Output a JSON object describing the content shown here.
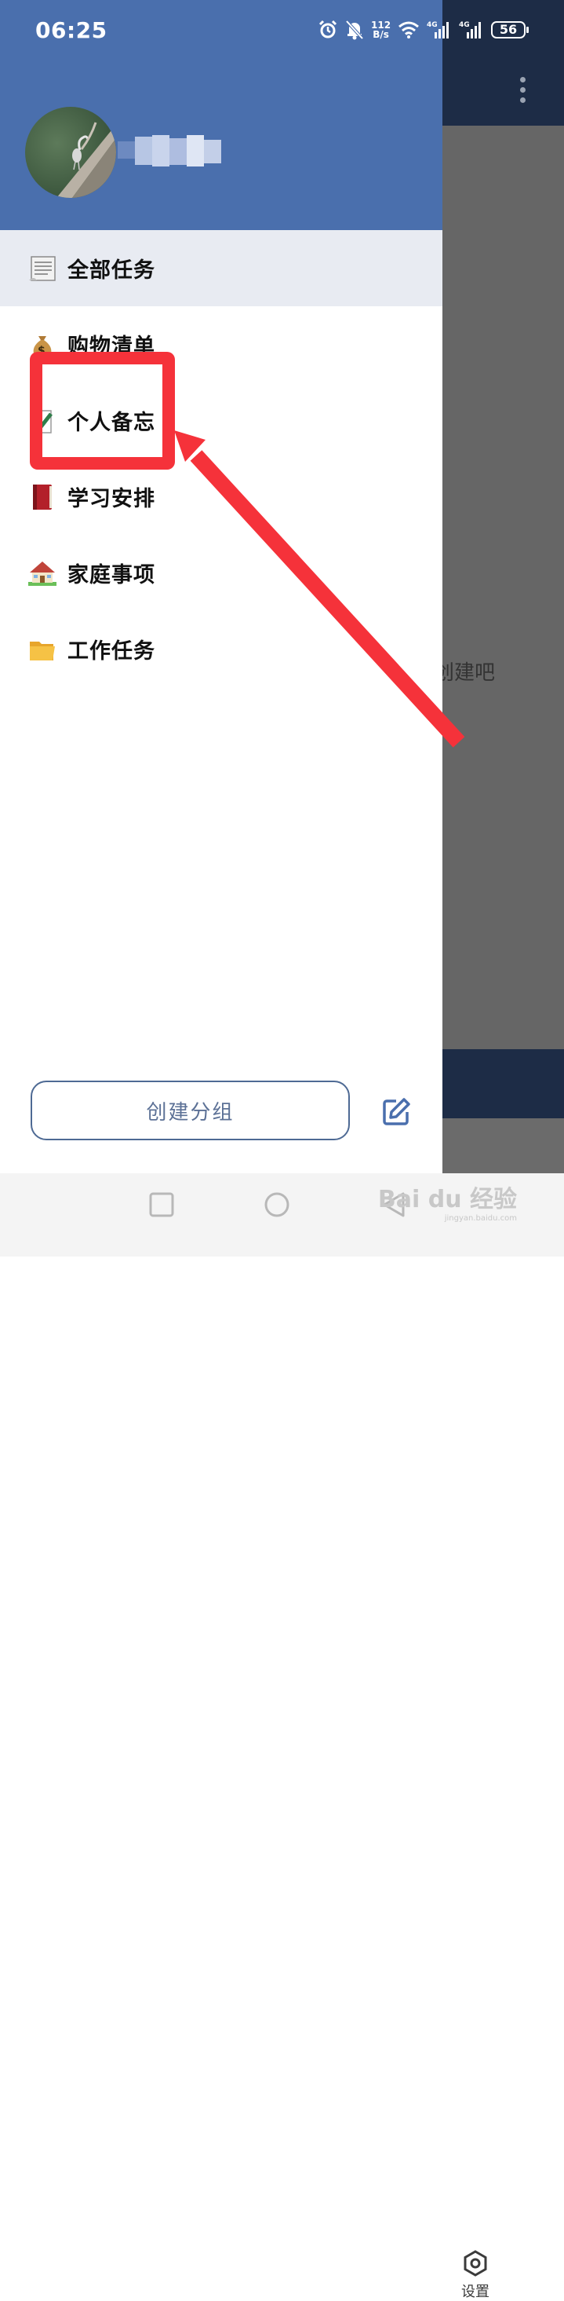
{
  "status_bar": {
    "time": "06:25",
    "net_speed_value": "112",
    "net_speed_unit": "B/s",
    "battery": "56",
    "icons": [
      "alarm-icon",
      "bell-off-icon",
      "wifi-icon",
      "signal-4g-icon",
      "signal-4g-icon",
      "battery-icon"
    ]
  },
  "drawer": {
    "nav_items": [
      {
        "label": "全部任务",
        "icon": "document-icon",
        "active": true
      },
      {
        "label": "购物清单",
        "icon": "money-bag-icon",
        "active": false
      },
      {
        "label": "个人备忘",
        "icon": "memo-icon",
        "active": false
      },
      {
        "label": "学习安排",
        "icon": "book-icon",
        "active": false
      },
      {
        "label": "家庭事项",
        "icon": "house-icon",
        "active": false
      },
      {
        "label": "工作任务",
        "icon": "folder-icon",
        "active": false
      }
    ],
    "create_group_label": "创建分组"
  },
  "background_app": {
    "empty_hint_fragment": "创建吧",
    "settings_label": "设置"
  },
  "watermark": {
    "text": "Bai du 经验",
    "subtext": "jingyan.baidu.com"
  },
  "colors": {
    "header": "#4a6fad",
    "active_item_bg": "#e8ebf2",
    "annotation": "#f5323a",
    "create_border": "#4e6a94"
  }
}
